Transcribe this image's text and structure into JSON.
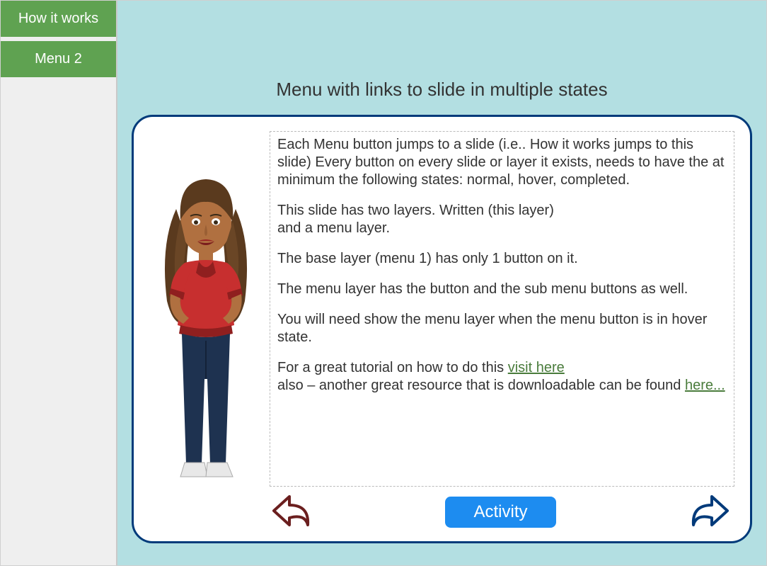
{
  "sidebar": {
    "items": [
      {
        "label": "How it works"
      },
      {
        "label": "Menu 2"
      }
    ]
  },
  "page": {
    "title": "Menu with links to slide in multiple states"
  },
  "content": {
    "p1": "Each Menu button jumps to a slide (i.e.. How it works jumps to this slide)  Every button on every slide or layer it exists, needs to have the at minimum the following states:  normal, hover, completed.",
    "p2a": "This slide has two layers. Written (this layer)",
    "p2b": "and a menu layer.",
    "p3": "The base layer (menu 1) has only 1 button on it.",
    "p4": "The menu layer has the button and the sub menu buttons as well.",
    "p5": "You will need show the menu layer when the menu button is in hover state.",
    "p6a": "For a great tutorial on how to do this ",
    "link1": "visit  here",
    "p6b": "also – another great resource that is downloadable can be found ",
    "link2": "here... "
  },
  "buttons": {
    "activity": "Activity"
  }
}
